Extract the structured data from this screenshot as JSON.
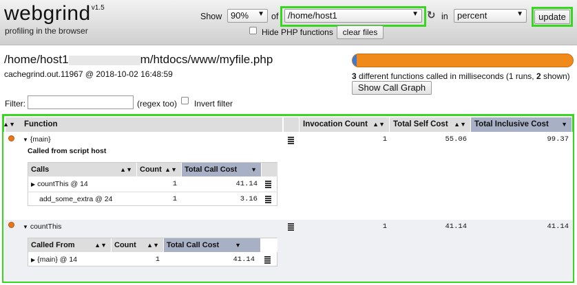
{
  "header": {
    "logo": "webgrind",
    "version": "v1.5",
    "tagline": "profiling in the browser",
    "show_label": "Show",
    "show_value": "90%",
    "of_label": "of",
    "file_value": "/home/host1",
    "in_label": "in",
    "unit_value": "percent",
    "update_label": "update",
    "hide_php_label": "Hide PHP functions",
    "clear_files_label": "clear files"
  },
  "info": {
    "filepath_start": "/home/host1",
    "filepath_end": "m/htdocs/www/myfile.php",
    "cachefile": "cachegrind.out.11967 @ 2018-10-02 16:48:59",
    "summary_count": "3",
    "summary_middle": "different functions called in milliseconds (1 runs,",
    "summary_shown": "2",
    "summary_end": "shown)",
    "show_call_graph": "Show Call Graph",
    "progress_fraction": 0.02
  },
  "filter": {
    "label": "Filter:",
    "regex_label": "(regex too)",
    "invert_label": "Invert filter"
  },
  "table": {
    "headers": {
      "function": "Function",
      "invocation": "Invocation Count",
      "self": "Total Self Cost",
      "inclusive": "Total Inclusive Cost"
    },
    "rows": [
      {
        "name": "{main}",
        "note": "Called from script host",
        "invocation": "1",
        "self": "55.06",
        "inclusive": "99.37",
        "sub_headers": {
          "name": "Calls",
          "count": "Count",
          "cost": "Total Call Cost"
        },
        "sub_rows": [
          {
            "name": "countThis @ 14",
            "count": "1",
            "cost": "41.14"
          },
          {
            "name": "add_some_extra @ 24",
            "count": "1",
            "cost": "3.16"
          }
        ]
      },
      {
        "name": "countThis",
        "invocation": "1",
        "self": "41.14",
        "inclusive": "41.14",
        "sub_headers": {
          "name": "Called From",
          "count": "Count",
          "cost": "Total Call Cost"
        },
        "sub_rows": [
          {
            "name": "{main} @ 14",
            "count": "1",
            "cost": "41.14"
          }
        ]
      }
    ]
  },
  "colors": {
    "highlight": "#36d71e",
    "progress_orange": "#f08a1b",
    "progress_blue": "#3c7ad6",
    "sorted_header": "#a8b0c6",
    "row_dot": "#e8761a"
  }
}
